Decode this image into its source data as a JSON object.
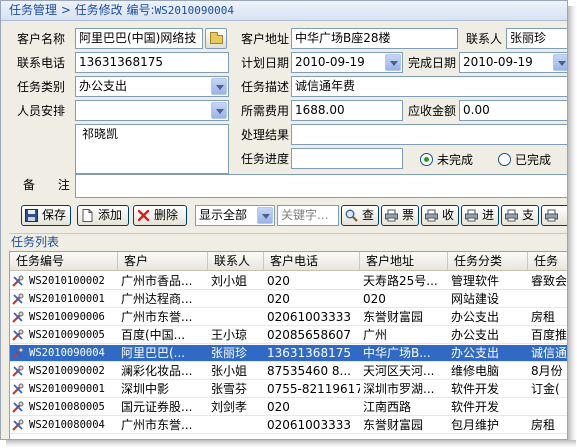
{
  "title": {
    "text": "任务管理 > 任务修改",
    "code_label": "编号:",
    "code": "WS2010090004"
  },
  "form": {
    "customer_name_label": "客户名称",
    "customer_name": "阿里巴巴(中国)网络技",
    "customer_address_label": "客户地址",
    "customer_address": "中华广场B座28楼",
    "contact_label": "联系人",
    "contact": "张丽珍",
    "phone_label": "联系电话",
    "phone": "13631368175",
    "plan_date_label": "计划日期",
    "plan_date": "2010-09-19",
    "done_date_label": "完成日期",
    "done_date": "2010-09-19",
    "category_label": "任务类别",
    "category": "办公支出",
    "desc_label": "任务描述",
    "desc": "诚信通年费",
    "staff_label": "人员安排",
    "staff_list": "祁晓凯",
    "cost_label": "所需费用",
    "cost": "1688.00",
    "receivable_label": "应收金额",
    "receivable": "0.00",
    "result_label": "处理结果",
    "progress_label": "任务进度",
    "radio_incomplete": "未完成",
    "radio_complete": "已完成",
    "remark_label": "备      注"
  },
  "toolbar": {
    "save": "保存",
    "add": "添加",
    "delete": "删除",
    "filter": "显示全部",
    "keyword_placeholder": "关键字...",
    "search": "查",
    "ticket": "票",
    "receive": "收",
    "in": "进",
    "pay": "支"
  },
  "list": {
    "section_title": "任务列表",
    "headers": [
      "任务编号",
      "客户",
      "联系人",
      "客户电话",
      "客户地址",
      "任务分类",
      "任务"
    ],
    "rows": [
      {
        "code": "WS2010100002",
        "customer": "广州市香品...",
        "contact": "刘小姐",
        "tel": "020",
        "addr": "天寿路25号...",
        "cat": "管理软件",
        "task": "睿致会"
      },
      {
        "code": "WS2010100001",
        "customer": "广州达程商...",
        "contact": "",
        "tel": "020",
        "addr": "020",
        "cat": "网站建设",
        "task": ""
      },
      {
        "code": "WS2010090006",
        "customer": "广州市东誉...",
        "contact": "",
        "tel": "02061003333",
        "addr": "东誉财富园",
        "cat": "办公支出",
        "task": "房租"
      },
      {
        "code": "WS2010090005",
        "customer": "百度(中国...",
        "contact": "王小琼",
        "tel": "02085658607",
        "addr": "广州",
        "cat": "办公支出",
        "task": "百度推"
      },
      {
        "code": "WS2010090004",
        "customer": "阿里巴巴(...",
        "contact": "张丽珍",
        "tel": "13631368175",
        "addr": "中华广场B...",
        "cat": "办公支出",
        "task": "诚信通"
      },
      {
        "code": "WS2010090002",
        "customer": "澜彩化妆品...",
        "contact": "张小姐",
        "tel": "87535460 8...",
        "addr": "天河区天河...",
        "cat": "维修电脑",
        "task": "8月份"
      },
      {
        "code": "WS2010090001",
        "customer": "深圳中影",
        "contact": "张雪芬",
        "tel": "0755-82119617",
        "addr": "深圳市罗湖...",
        "cat": "软件开发",
        "task": "订金("
      },
      {
        "code": "WS2010080005",
        "customer": "国元证券股...",
        "contact": "刘剑孝",
        "tel": "020",
        "addr": "江南西路",
        "cat": "软件开发",
        "task": ""
      },
      {
        "code": "WS2010080004",
        "customer": "广州市东誉...",
        "contact": "",
        "tel": "02061003333",
        "addr": "东誉财富园",
        "cat": "包月维护",
        "task": "房租"
      }
    ],
    "selected_index": 4
  }
}
